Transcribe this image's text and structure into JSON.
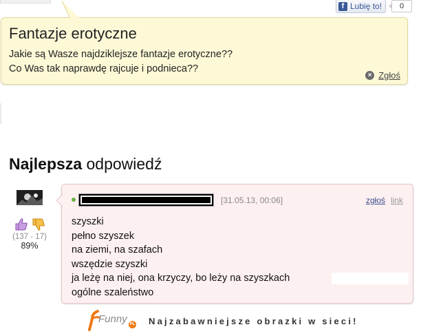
{
  "like": {
    "label": "Lubię to!",
    "count": "0",
    "icon": "f"
  },
  "question": {
    "title": "Fantazje erotyczne",
    "lines": [
      "Jakie są Wasze najdziklejsze fantazje erotyczne??",
      "Co Was tak naprawdę rajcuje i podnieca??"
    ],
    "report_label": "Zgłoś"
  },
  "best_answer": {
    "heading_bold": "Najlepsza",
    "heading_rest": " odpowiedź"
  },
  "answer": {
    "timestamp": "[31.05.13, 00:06]",
    "report_label": "zgłoś",
    "link_label": "link",
    "lines": [
      "szyszki",
      "pełno szyszek",
      "na ziemi, na szafach",
      "wszędzie szyszki",
      "ja leżę na niej, ona krzyczy, bo leży na szyszkach",
      "ogólne szaleństwo"
    ],
    "votes": {
      "range": "(137 - 17)",
      "percent": "89%"
    }
  },
  "footer": {
    "logo_text": "Funny",
    "logo_badge": "PL",
    "tagline": "Najzabawniejsze obrazki w sieci!"
  },
  "colors": {
    "question_bg": "#fdf9d7",
    "answer_bg": "#fdf0f1",
    "thumb_up": "#a56bc7",
    "thumb_down": "#f0b22b",
    "logo_orange": "#f07a15"
  }
}
